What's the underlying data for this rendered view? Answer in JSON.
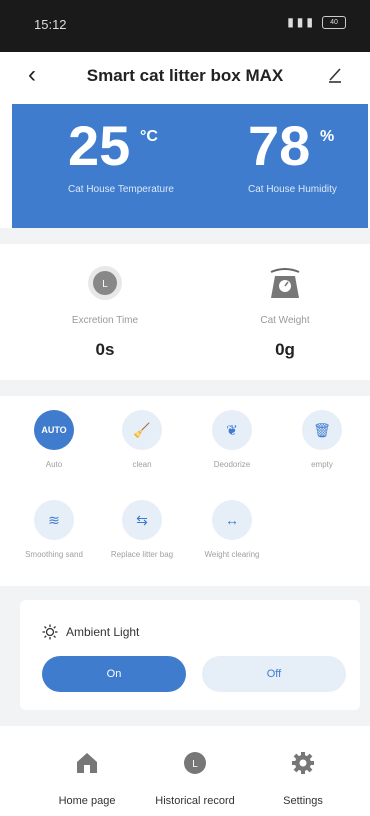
{
  "status_bar": {
    "time": "15:12",
    "battery": "40"
  },
  "header": {
    "title": "Smart cat litter box MAX"
  },
  "climate": {
    "temperature": {
      "value": "25",
      "unit": "°C",
      "label": "Cat House Temperature"
    },
    "humidity": {
      "value": "78",
      "unit": "%",
      "label": "Cat House Humidity"
    }
  },
  "stats": {
    "excretion": {
      "label": "Excretion Time",
      "value": "0s"
    },
    "weight": {
      "label": "Cat Weight",
      "value": "0g"
    }
  },
  "functions": [
    {
      "label": "Auto",
      "icon": "auto-icon",
      "glyph": "AUTO",
      "active": true
    },
    {
      "label": "clean",
      "icon": "broom-icon",
      "glyph": "🧹",
      "active": false
    },
    {
      "label": "Deodorize",
      "icon": "leaf-icon",
      "glyph": "❦",
      "active": false
    },
    {
      "label": "empty",
      "icon": "trash-icon",
      "glyph": "🗑",
      "active": false
    },
    {
      "label": "Smoothing sand",
      "icon": "waves-icon",
      "glyph": "≋",
      "active": false
    },
    {
      "label": "Replace litter bag",
      "icon": "swap-icon",
      "glyph": "⇆",
      "active": false
    },
    {
      "label": "Weight clearing",
      "icon": "arrows-icon",
      "glyph": "↔",
      "active": false
    }
  ],
  "ambient": {
    "title": "Ambient Light",
    "on_label": "On",
    "off_label": "Off"
  },
  "tabs": {
    "home": "Home page",
    "history": "Historical record",
    "settings": "Settings"
  },
  "colors": {
    "accent": "#3f7ccd",
    "accent_light": "#e6eef8",
    "page_gap": "#f2f3f5"
  }
}
